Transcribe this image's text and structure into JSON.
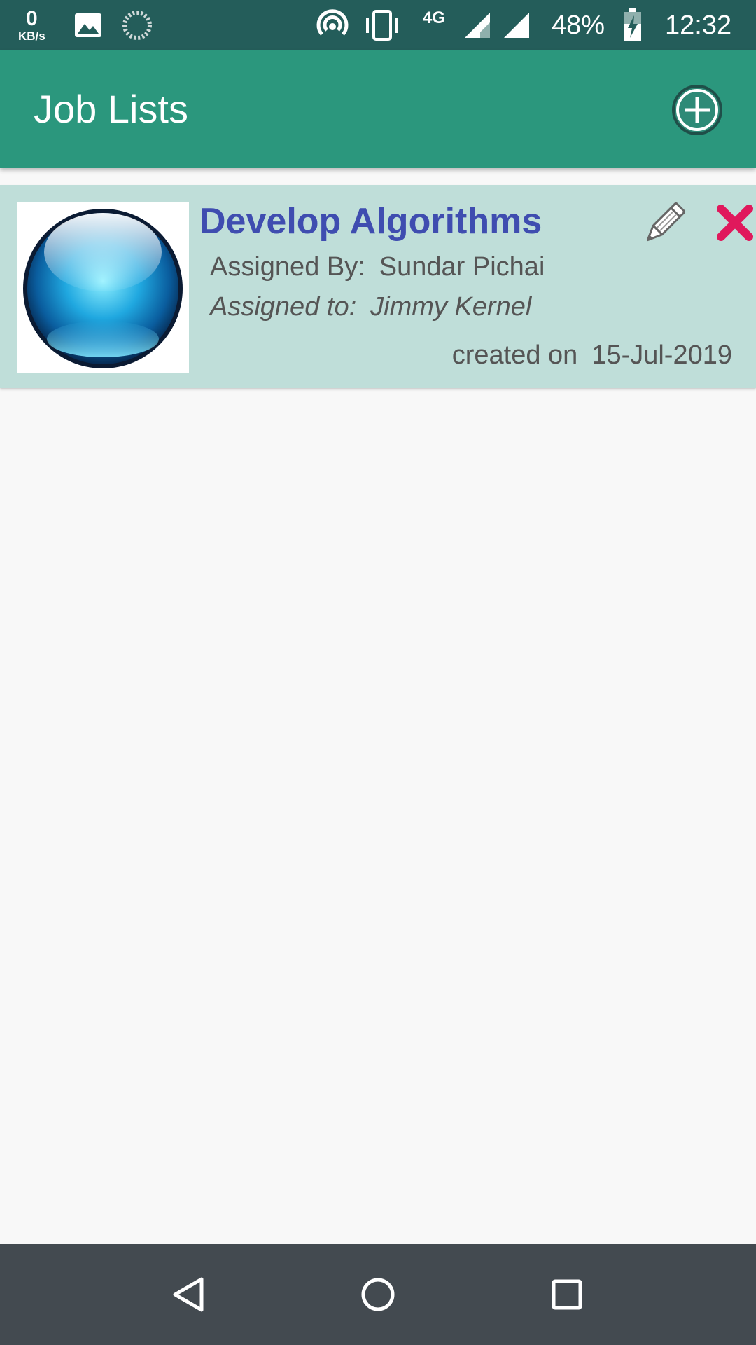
{
  "status_bar": {
    "net_speed_value": "0",
    "net_speed_unit": "KB/s",
    "network_type": "4G",
    "battery": "48%",
    "time": "12:32",
    "icons": [
      "image-icon",
      "sync-spinner-icon",
      "hotspot-icon",
      "vibrate-icon",
      "signal-icon",
      "battery-charging-icon"
    ]
  },
  "app_bar": {
    "title": "Job Lists",
    "add_icon": "add-circle-icon"
  },
  "jobs": [
    {
      "title": "Develop Algorithms",
      "assigned_by_label": "Assigned By:",
      "assigned_by": "Sundar Pichai",
      "assigned_to_label": "Assigned to:",
      "assigned_to": "Jimmy Kernel",
      "created_label": "created on",
      "created_date": "15-Jul-2019",
      "thumbnail": "blue-orb-image",
      "edit_icon": "pencil-icon",
      "delete_icon": "close-icon"
    }
  ],
  "nav_bar": {
    "back": "back-icon",
    "home": "home-icon",
    "recents": "recents-icon"
  },
  "colors": {
    "status_bar": "#245d5a",
    "app_bar": "#2b977d",
    "card": "#bfded9",
    "job_title": "#3f4db0",
    "delete": "#e0185c",
    "nav_bar": "#434a50"
  }
}
